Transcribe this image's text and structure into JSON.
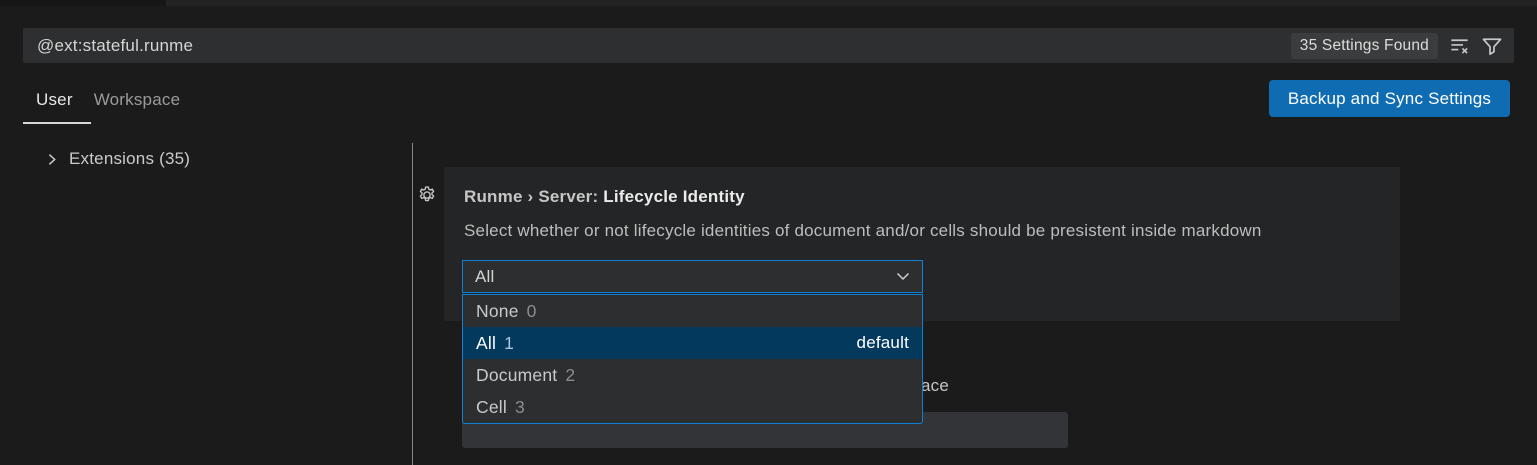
{
  "colors": {
    "page_bg": "#1b1b1c",
    "strip_bg": "#232324",
    "strip_dark": "#161617",
    "input_bg": "#2e2f30",
    "badge_bg": "#3b3c3d",
    "row_bg": "#242526",
    "control_bg": "#2d2e2f",
    "field_bg": "#333438",
    "accent": "#1080d4",
    "selection_bg": "#04395e",
    "button_bg": "#0f6cb3",
    "divider": "#878787"
  },
  "search": {
    "query": "@ext:stateful.runme",
    "results_badge": "35 Settings Found"
  },
  "icons": {
    "search_actions": [
      "clear-search-results",
      "filter"
    ],
    "toc": "chevron-right",
    "setting": "gear",
    "select": "chevron-down"
  },
  "tabs": {
    "user": "User",
    "workspace": "Workspace"
  },
  "actions": {
    "backup_sync": "Backup and Sync Settings"
  },
  "toc": {
    "extensions": "Extensions (35)"
  },
  "setting": {
    "title_prefix": "Runme › Server: ",
    "title_name": "Lifecycle Identity",
    "description": "Select whether or not lifecycle identities of document and/or cells should be presistent inside markdown",
    "value": "All",
    "options": [
      {
        "name": "None",
        "num": "0",
        "badge": ""
      },
      {
        "name": "All",
        "num": "1",
        "badge": "default"
      },
      {
        "name": "Document",
        "num": "2",
        "badge": ""
      },
      {
        "name": "Cell",
        "num": "3",
        "badge": ""
      }
    ]
  },
  "next_setting": {
    "visible_fragment": "ace"
  }
}
